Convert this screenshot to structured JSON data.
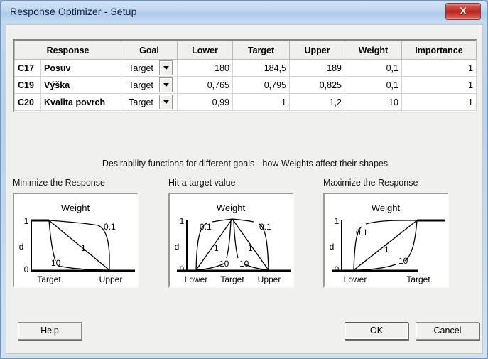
{
  "window": {
    "title": "Response Optimizer - Setup",
    "close_icon": "close-icon",
    "close_glyph": "X"
  },
  "table": {
    "headers": [
      "Response",
      "Goal",
      "Lower",
      "Target",
      "Upper",
      "Weight",
      "Importance"
    ],
    "rows": [
      {
        "id": "C17",
        "name": "Posuv",
        "goal": "Target",
        "lower": "180",
        "target": "184,5",
        "upper": "189",
        "weight": "0,1",
        "importance": "1"
      },
      {
        "id": "C19",
        "name": "Výška",
        "goal": "Target",
        "lower": "0,765",
        "target": "0,795",
        "upper": "0,825",
        "weight": "0,1",
        "importance": "1"
      },
      {
        "id": "C20",
        "name": "Kvalita povrch",
        "goal": "Target",
        "lower": "0,99",
        "target": "1",
        "upper": "1,2",
        "weight": "10",
        "importance": "1"
      }
    ],
    "goal_options": [
      "Target"
    ]
  },
  "caption": "Desirability functions for different goals - how Weights affect their shapes",
  "charts": [
    {
      "heading": "Minimize the Response",
      "plot_title": "Weight",
      "y_top_label": "1",
      "y_bottom_label": "0",
      "y_axis_label": "d",
      "x_labels": [
        "Target",
        "Upper"
      ],
      "curve_labels": [
        "0.1",
        "1",
        "10"
      ]
    },
    {
      "heading": "Hit a target value",
      "plot_title": "Weight",
      "y_top_label": "1",
      "y_bottom_label": "0",
      "y_axis_label": "d",
      "x_labels": [
        "Lower",
        "Target",
        "Upper"
      ],
      "curve_labels": [
        "0.1",
        "0.1",
        "1",
        "1",
        "10",
        "10"
      ]
    },
    {
      "heading": "Maximize the Response",
      "plot_title": "Weight",
      "y_top_label": "1",
      "y_bottom_label": "0",
      "y_axis_label": "d",
      "x_labels": [
        "Lower",
        "Target"
      ],
      "curve_labels": [
        "0.1",
        "1",
        "10"
      ]
    }
  ],
  "buttons": {
    "help": "Help",
    "ok": "OK",
    "cancel": "Cancel"
  }
}
